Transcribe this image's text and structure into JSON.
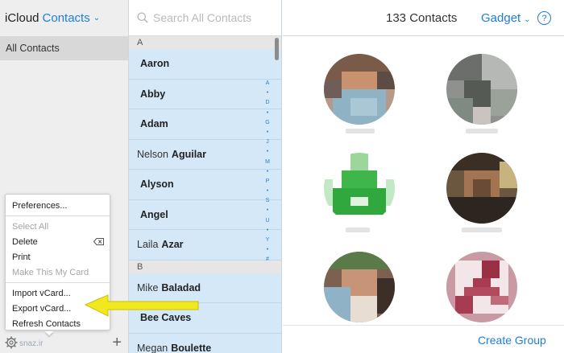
{
  "sidebar": {
    "app_name": "iCloud",
    "title": "Contacts",
    "group": "All Contacts",
    "watermark": "snaz.ir"
  },
  "menu": {
    "items": [
      {
        "label": "Preferences...",
        "enabled": true
      },
      {
        "label": "Select All",
        "enabled": false
      },
      {
        "label": "Delete",
        "enabled": true
      },
      {
        "label": "Print",
        "enabled": true
      },
      {
        "label": "Make This My Card",
        "enabled": false
      },
      {
        "label": "Import vCard...",
        "enabled": true
      },
      {
        "label": "Export vCard...",
        "enabled": true
      },
      {
        "label": "Refresh Contacts",
        "enabled": true
      }
    ]
  },
  "search": {
    "placeholder": "Search All Contacts"
  },
  "list": {
    "sections": [
      {
        "letter": "A",
        "contacts": [
          {
            "first": "",
            "last": "Aaron"
          },
          {
            "first": "",
            "last": "Abby"
          },
          {
            "first": "",
            "last": "Adam"
          },
          {
            "first": "Nelson",
            "last": "Aguilar"
          },
          {
            "first": "",
            "last": "Alyson"
          },
          {
            "first": "",
            "last": "Angel"
          },
          {
            "first": "Laila",
            "last": "Azar"
          }
        ]
      },
      {
        "letter": "B",
        "contacts": [
          {
            "first": "Mike",
            "last": "Baladad"
          },
          {
            "first": "",
            "last": "Bee Caves"
          },
          {
            "first": "Megan",
            "last": "Boulette"
          }
        ]
      }
    ],
    "index_letters": [
      "A",
      "•",
      "D",
      "•",
      "G",
      "•",
      "J",
      "•",
      "M",
      "•",
      "P",
      "•",
      "S",
      "•",
      "U",
      "•",
      "Y",
      "•",
      "#"
    ]
  },
  "detail": {
    "count_label": "133 Contacts",
    "user_name": "Gadget",
    "help_label": "?",
    "create_group_label": "Create Group"
  },
  "colors": {
    "accent": "#1d7ee0",
    "list_background": "#d5e8f8",
    "arrow": "#f2e820"
  }
}
